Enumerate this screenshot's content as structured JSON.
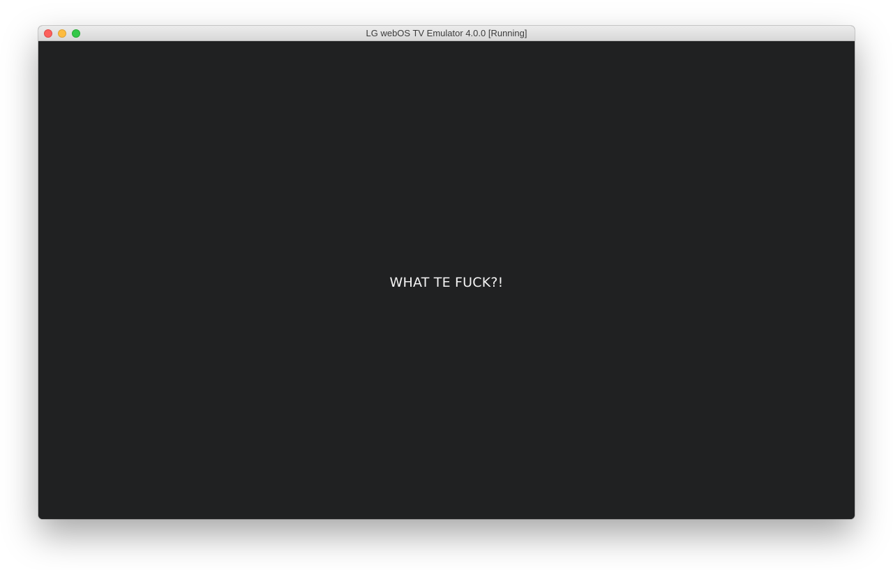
{
  "window": {
    "title": "LG webOS TV Emulator 4.0.0 [Running]",
    "controls": {
      "close_icon": "close-icon",
      "minimize_icon": "minimize-icon",
      "zoom_icon": "zoom-icon"
    }
  },
  "screen": {
    "message": "WHAT TE FUCK?!",
    "background_color": "#202122",
    "text_color": "#f4f4f4"
  }
}
